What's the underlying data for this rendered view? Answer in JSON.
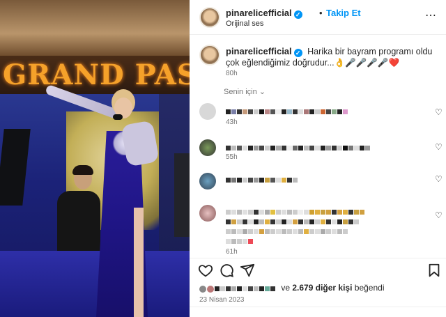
{
  "media": {
    "sign_text": "GRAND PAS"
  },
  "post": {
    "username": "pinarelicefficial",
    "verified_badge": "✓",
    "separator": "•",
    "follow_label": "Takip Et",
    "audio_label": "Orijinal ses",
    "more_icon": "⋯",
    "caption_username": "pinarelicefficial",
    "caption_text": "Harika bir bayram programı oldu çok eğlendiğimiz doğrudur...👌🎤🎤🎤🎤❤️",
    "caption_time": "80h",
    "for_you_label": "Senin için ⌄"
  },
  "comments": [
    {
      "time": "43h",
      "heart": "♡"
    },
    {
      "time": "55h",
      "heart": "♡"
    },
    {
      "time": "",
      "heart": "♡"
    },
    {
      "time": "61h",
      "heart": "♡"
    }
  ],
  "actions": {
    "like_icon": "heart-outline-icon",
    "comment_icon": "comment-icon",
    "share_icon": "send-icon",
    "save_icon": "bookmark-icon"
  },
  "likes": {
    "prefix": "ve",
    "count_text": "2.679 diğer kişi",
    "suffix": "beğendi"
  },
  "date": "23 Nisan 2023",
  "colors": {
    "accent": "#0095f6",
    "text": "#262626",
    "secondary": "#737373",
    "stage_blue": "#1b1c5e",
    "sign_orange": "#f5a12a"
  }
}
